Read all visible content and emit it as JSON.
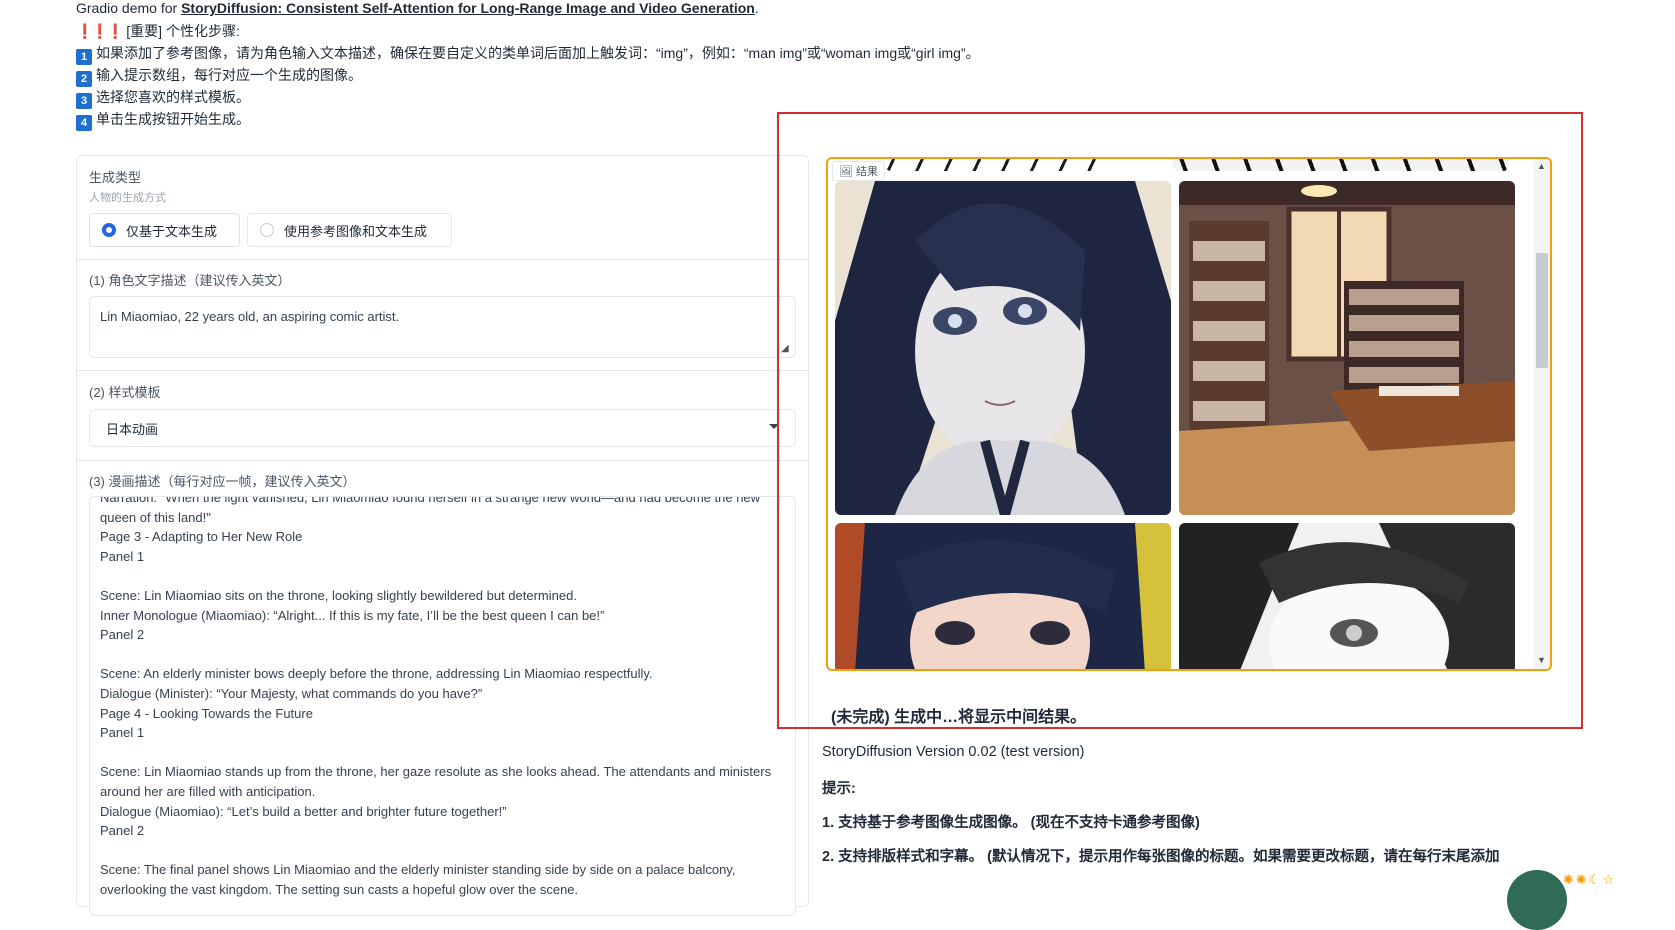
{
  "header": {
    "demo_prefix": "Gradio demo for ",
    "demo_link": "StoryDiffusion: Consistent Self-Attention for Long-Range Image and Video Generation",
    "demo_suffix": ".",
    "steps_title": "[重要] 个性化步骤:",
    "steps": [
      {
        "num": "1",
        "text": "如果添加了参考图像，请为角色输入文本描述，确保在要自定义的类单词后面加上触发词：“img”，例如：“man img”或“woman img或“girl img”。"
      },
      {
        "num": "2",
        "text": "输入提示数组，每行对应一个生成的图像。"
      },
      {
        "num": "3",
        "text": "选择您喜欢的样式模板。"
      },
      {
        "num": "4",
        "text": "单击生成按钮开始生成。"
      }
    ]
  },
  "form": {
    "gen_type_label": "生成类型",
    "gen_type_sub": "人物的生成方式",
    "radio_text_only": "仅基于文本生成",
    "radio_ref_image": "使用参考图像和文本生成",
    "char_desc_label": "(1) 角色文字描述（建议传入英文）",
    "char_desc_value": "Lin Miaomiao, 22 years old, an aspiring comic artist.",
    "style_label": "(2) 样式模板",
    "style_value": "日本动画",
    "comic_label": "(3) 漫画描述（每行对应一帧，建议传入英文）",
    "comic_lines": [
      "Narration: \"When the light vanished, Lin Miaomiao found herself in a strange new world—and had become the new",
      "queen of this land!\"",
      "Page 3 - Adapting to Her New Role",
      "Panel 1",
      "",
      "Scene: Lin Miaomiao sits on the throne, looking slightly bewildered but determined.",
      "Inner Monologue (Miaomiao): “Alright... If this is my fate, I’ll be the best queen I can be!”",
      "Panel 2",
      "",
      "Scene: An elderly minister bows deeply before the throne, addressing Lin Miaomiao respectfully.",
      "Dialogue (Minister): “Your Majesty, what commands do you have?”",
      "Page 4 - Looking Towards the Future",
      "Panel 1",
      "",
      "Scene: Lin Miaomiao stands up from the throne, her gaze resolute as she looks ahead. The attendants and ministers",
      "around her are filled with anticipation.",
      "Dialogue (Miaomiao): “Let’s build a better and brighter future together!”",
      "Panel 2",
      "",
      "Scene: The final panel shows Lin Miaomiao and the elderly minister standing side by side on a palace balcony,",
      "overlooking the vast kingdom. The setting sun casts a hopeful glow over the scene."
    ]
  },
  "result": {
    "gallery_label": "结果",
    "status": "(未完成) 生成中…将显示中间结果。"
  },
  "info": {
    "version": "StoryDiffusion Version 0.02 (test version)",
    "tips_title": "提示:",
    "tip1": "1. 支持基于参考图像生成图像。 (现在不支持卡通参考图像)",
    "tip2": "2. 支持排版样式和字幕。 (默认情况下，提示用作每张图像的标题。如果需要更改标题，请在每行末尾添加"
  },
  "colors": {
    "accent": "#2563eb",
    "highlight": "#d32f2f",
    "gallery_border": "#f59e0b"
  }
}
